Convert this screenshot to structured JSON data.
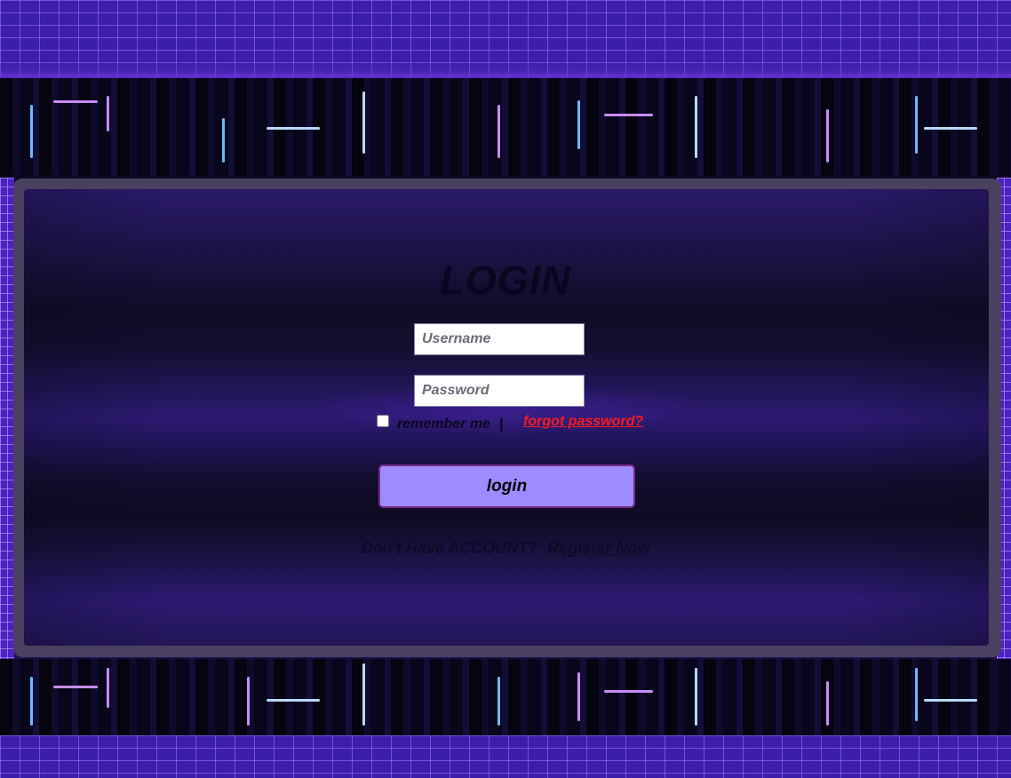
{
  "page": {
    "title": "LOGIN"
  },
  "form": {
    "username_placeholder": "Username",
    "username_value": "",
    "password_placeholder": "Password",
    "password_value": "",
    "remember_label": "remember me",
    "separator": "|",
    "remember_checked": false,
    "forgot_label": "forgot password?",
    "submit_label": "login"
  },
  "footer": {
    "prompt": "Don't Have ACCOUNT?",
    "register_label": "Register Now"
  },
  "colors": {
    "accent_button": "#9d8cff",
    "forgot_link": "#ff1a1a",
    "panel_frame": "#49415f",
    "background": "#140a33"
  }
}
